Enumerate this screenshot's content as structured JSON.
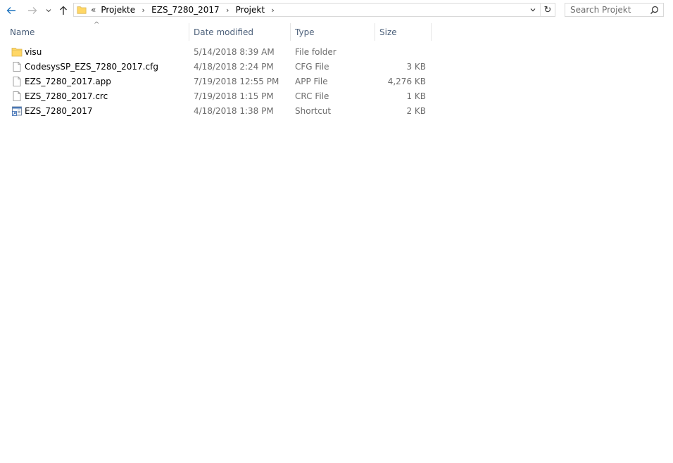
{
  "nav": {
    "back_icon": "arrow-left-icon",
    "forward_icon": "arrow-right-icon",
    "recent_icon": "chevron-down-icon",
    "up_icon": "arrow-up-icon",
    "accent": "#1e73be"
  },
  "address": {
    "overflow": "«",
    "crumbs": [
      "Projekte",
      "EZS_7280_2017",
      "Projekt"
    ],
    "separator": "›",
    "refresh_glyph": "↻"
  },
  "search": {
    "placeholder": "Search Projekt",
    "value": ""
  },
  "columns": {
    "name": "Name",
    "date": "Date modified",
    "type": "Type",
    "size": "Size"
  },
  "files": [
    {
      "name": "visu",
      "date": "5/14/2018 8:39 AM",
      "type": "File folder",
      "size": "",
      "icon": "folder-icon"
    },
    {
      "name": "CodesysSP_EZS_7280_2017.cfg",
      "date": "4/18/2018 2:24 PM",
      "type": "CFG File",
      "size": "3 KB",
      "icon": "file-icon"
    },
    {
      "name": "EZS_7280_2017.app",
      "date": "7/19/2018 12:55 PM",
      "type": "APP File",
      "size": "4,276 KB",
      "icon": "file-icon"
    },
    {
      "name": "EZS_7280_2017.crc",
      "date": "7/19/2018 1:15 PM",
      "type": "CRC File",
      "size": "1 KB",
      "icon": "file-icon"
    },
    {
      "name": "EZS_7280_2017",
      "date": "4/18/2018 1:38 PM",
      "type": "Shortcut",
      "size": "2 KB",
      "icon": "shortcut-icon"
    }
  ],
  "colors": {
    "header_text": "#4c607a",
    "muted_text": "#6d6d6d",
    "folder_yellow": "#ffd766"
  }
}
